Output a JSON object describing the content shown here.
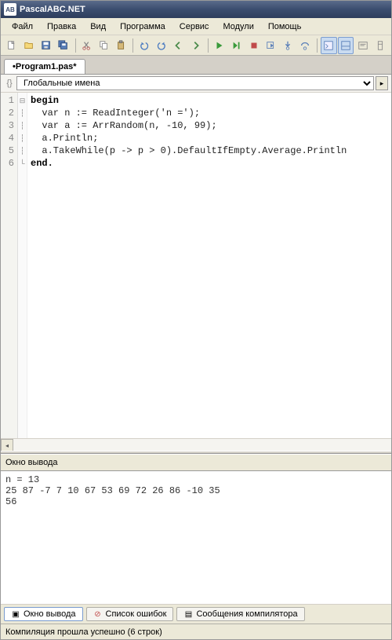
{
  "window": {
    "title": "PascalABC.NET"
  },
  "menu": {
    "file": "Файл",
    "edit": "Правка",
    "view": "Вид",
    "program": "Программа",
    "service": "Сервис",
    "modules": "Модули",
    "help": "Помощь"
  },
  "tabs": {
    "file1": "•Program1.pas*"
  },
  "scope": {
    "selected": "Глобальные имена"
  },
  "code": {
    "line1": "begin",
    "line2": "  var n := ReadInteger('n =');",
    "line3": "  var a := ArrRandom(n, -10, 99);",
    "line4": "  a.Println;",
    "line5": "  a.TakeWhile(p -> p > 0).DefaultIfEmpty.Average.Println",
    "line6": "end."
  },
  "gutter": {
    "l1": "1",
    "l2": "2",
    "l3": "3",
    "l4": "4",
    "l5": "5",
    "l6": "6"
  },
  "output": {
    "label": "Окно вывода",
    "content": "n = 13\n25 87 -7 7 10 67 53 69 72 26 86 -10 35\n56"
  },
  "bottom_tabs": {
    "output": "Окно вывода",
    "errors": "Список ошибок",
    "compiler": "Сообщения компилятора"
  },
  "status": {
    "text": "Компиляция прошла успешно (6 строк)"
  }
}
